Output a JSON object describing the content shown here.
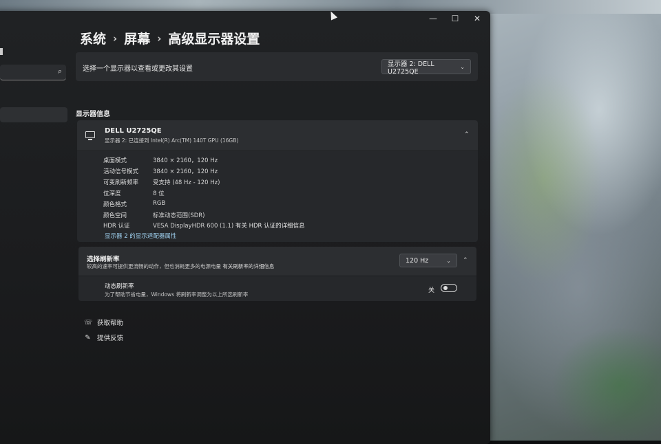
{
  "breadcrumb": {
    "item1": "系统",
    "item2": "屏幕",
    "item3": "高级显示器设置"
  },
  "select_display": {
    "label": "选择一个显示器以查看或更改其设置",
    "dropdown_value": "显示器 2: DELL U2725QE"
  },
  "display_info": {
    "section_title": "显示器信息",
    "monitor_name": "DELL U2725QE",
    "monitor_sub": "显示器 2: 已连接到 Intel(R) Arc(TM) 140T GPU (16GB)",
    "rows": [
      {
        "key": "桌面模式",
        "value": "3840 × 2160，120 Hz"
      },
      {
        "key": "活动信号模式",
        "value": "3840 × 2160，120 Hz"
      },
      {
        "key": "可变刷新频率",
        "value": "受支持 (48 Hz - 120 Hz)"
      },
      {
        "key": "位深度",
        "value": "8 位"
      },
      {
        "key": "颜色格式",
        "value": "RGB"
      },
      {
        "key": "颜色空间",
        "value": "标准动态范围(SDR)"
      },
      {
        "key": "HDR 认证",
        "value": "VESA DisplayHDR 600 (1.1)",
        "link": "有关 HDR 认证的详细信息"
      }
    ],
    "adapter_link": "显示器 2 的显示适配器属性"
  },
  "refresh": {
    "title": "选择刷新率",
    "desc": "较高的速率可提供更流畅的动作，但也消耗更多的电源电量",
    "desc_link": "有关刷新率的详细信息",
    "dropdown_value": "120 Hz"
  },
  "dynamic_refresh": {
    "title": "动态刷新率",
    "desc": "为了帮助节省电量，Windows 将刷新率调整为以上所选刷新率",
    "toggle_label": "关",
    "toggle_state": "off"
  },
  "footer": {
    "help": "获取帮助",
    "feedback": "提供反馈"
  },
  "icons": {
    "minimize": "minimize-icon",
    "maximize": "maximize-icon",
    "close": "close-icon",
    "search": "search-icon",
    "monitor": "monitor-icon",
    "help": "help-icon",
    "feedback": "feedback-icon"
  },
  "colors": {
    "window_bg": "#1b1c1e",
    "card_bg": "#2a2c2f",
    "link": "#9fd0ef"
  }
}
